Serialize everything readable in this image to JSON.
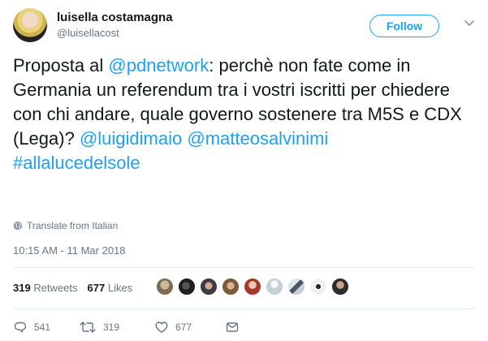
{
  "user": {
    "name": "luisella costamagna",
    "handle": "@luisellacost"
  },
  "follow_label": "Follow",
  "tweet": {
    "t1": "Proposta al ",
    "mention1": "@pdnetwork",
    "t2": ": perchè non fate come in Germania un referendum tra i vostri iscritti per chiedere con chi andare, quale governo sostenere tra M5S e CDX (Lega)? ",
    "mention2": "@luigidimaio",
    "t3": " ",
    "mention3": "@matteosalvinimi",
    "t4": " ",
    "hashtag": "#allalucedelsole"
  },
  "translate_label": "Translate from Italian",
  "timestamp": "10:15 AM - 11 Mar 2018",
  "stats": {
    "retweets_count": "319",
    "retweets_label": "Retweets",
    "likes_count": "677",
    "likes_label": "Likes"
  },
  "actions": {
    "replies": "541",
    "retweets": "319",
    "likes": "677"
  },
  "colors": {
    "link": "#1da1f2",
    "muted": "#657786",
    "text": "#14171a"
  }
}
